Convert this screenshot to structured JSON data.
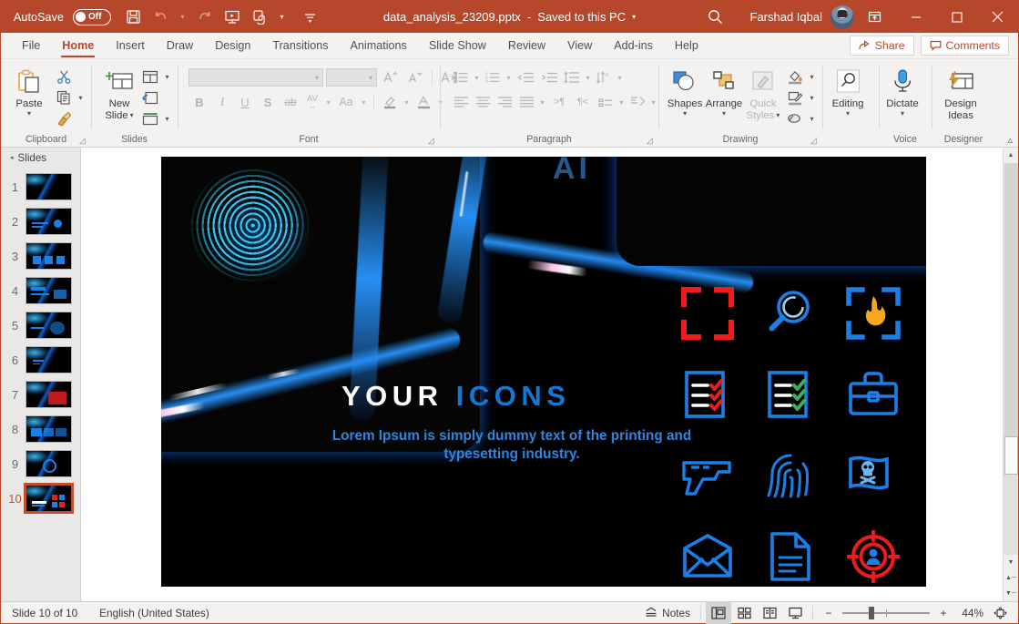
{
  "titlebar": {
    "autosave_label": "AutoSave",
    "autosave_state": "Off",
    "file_name": "data_analysis_23209.pptx",
    "separator": "-",
    "save_state": "Saved to this PC",
    "user_name": "Farshad Iqbal",
    "quick_access": [
      "save-icon",
      "undo-icon",
      "redo-icon",
      "start-presentation-icon",
      "touch-mode-icon"
    ],
    "search_icon": "search-icon",
    "window_buttons": [
      "ribbon-display-options",
      "minimize",
      "maximize",
      "close"
    ]
  },
  "ribbon": {
    "tabs": [
      {
        "label": "File",
        "active": false
      },
      {
        "label": "Home",
        "active": true
      },
      {
        "label": "Insert",
        "active": false
      },
      {
        "label": "Draw",
        "active": false
      },
      {
        "label": "Design",
        "active": false
      },
      {
        "label": "Transitions",
        "active": false
      },
      {
        "label": "Animations",
        "active": false
      },
      {
        "label": "Slide Show",
        "active": false
      },
      {
        "label": "Review",
        "active": false
      },
      {
        "label": "View",
        "active": false
      },
      {
        "label": "Add-ins",
        "active": false
      },
      {
        "label": "Help",
        "active": false
      }
    ],
    "share_label": "Share",
    "comments_label": "Comments",
    "groups": {
      "clipboard": {
        "label": "Clipboard",
        "paste_label": "Paste",
        "cut_label": "Cut",
        "copy_label": "Copy",
        "format_painter_label": "Format Painter"
      },
      "slides": {
        "label": "Slides",
        "new_slide_label": "New\nSlide",
        "new_slide_line1": "New",
        "new_slide_line2": "Slide",
        "layout_label": "Layout",
        "reset_label": "Reset",
        "section_label": "Section"
      },
      "font": {
        "label": "Font",
        "font_name_value": "",
        "font_size_value": "",
        "bold": "B",
        "italic": "I",
        "underline": "U",
        "shadow": "S",
        "strikethrough": "ab",
        "char_spacing": "AV",
        "change_case": "Aa",
        "grow_font": "A",
        "shrink_font": "A",
        "clear_formatting": "A"
      },
      "paragraph": {
        "label": "Paragraph"
      },
      "drawing": {
        "label": "Drawing",
        "shapes_label": "Shapes",
        "arrange_label": "Arrange",
        "quick_styles_line1": "Quick",
        "quick_styles_line2": "Styles"
      },
      "editing": {
        "label": "Editing",
        "editing_label": "Editing"
      },
      "voice": {
        "label": "Voice",
        "dictate_label": "Dictate"
      },
      "designer": {
        "label": "Designer",
        "design_ideas_line1": "Design",
        "design_ideas_line2": "Ideas"
      }
    }
  },
  "slide_panel": {
    "header": "Slides",
    "thumbnails": [
      {
        "number": "1",
        "selected": false
      },
      {
        "number": "2",
        "selected": false
      },
      {
        "number": "3",
        "selected": false
      },
      {
        "number": "4",
        "selected": false
      },
      {
        "number": "5",
        "selected": false
      },
      {
        "number": "6",
        "selected": false
      },
      {
        "number": "7",
        "selected": false
      },
      {
        "number": "8",
        "selected": false
      },
      {
        "number": "9",
        "selected": false
      },
      {
        "number": "10",
        "selected": true
      }
    ]
  },
  "slide": {
    "title_word1": "YOUR",
    "title_word2": "ICONS",
    "subtitle": "Lorem Ipsum is simply dummy text of the printing and typesetting industry.",
    "background_description": "fingerprint-on-glowing-blue-keyboard-photo",
    "ghost_text": "AI",
    "colors": {
      "accent_blue": "#1677d2",
      "subtitle_blue": "#2e86de",
      "icon_blue": "#1b7fe8",
      "icon_red": "#ee1c1c",
      "icon_green": "#3fae5a",
      "icon_orange": "#f5a81c",
      "background": "#000000"
    },
    "icons": [
      {
        "name": "scan-frame-red-icon",
        "color": "#ee1c1c"
      },
      {
        "name": "magnifier-icon",
        "color": "#1b7fe8"
      },
      {
        "name": "fire-scan-frame-icon",
        "color": "#1b7fe8"
      },
      {
        "name": "spacer",
        "color": ""
      },
      {
        "name": "checklist-red-icon",
        "color": "#ee1c1c"
      },
      {
        "name": "checklist-green-icon",
        "color": "#3fae5a"
      },
      {
        "name": "briefcase-icon",
        "color": "#1b7fe8"
      },
      {
        "name": "gavel-icon",
        "color": "#1b7fe8"
      },
      {
        "name": "gun-icon",
        "color": "#1b7fe8"
      },
      {
        "name": "fingerprint-icon",
        "color": "#1b7fe8"
      },
      {
        "name": "pirate-flag-icon",
        "color": "#1b7fe8"
      },
      {
        "name": "user-icon",
        "color": "#1b7fe8"
      },
      {
        "name": "envelope-icon",
        "color": "#1b7fe8"
      },
      {
        "name": "document-icon",
        "color": "#1b7fe8"
      },
      {
        "name": "target-person-icon",
        "color": "#ee1c1c"
      },
      {
        "name": "network-nodes-icon",
        "color": "#1b7fe8"
      }
    ]
  },
  "statusbar": {
    "slide_counter": "Slide 10 of 10",
    "language": "English (United States)",
    "notes_label": "Notes",
    "views": [
      "normal-view",
      "slide-sorter-view",
      "reading-view",
      "slideshow-view"
    ],
    "zoom_out": "−",
    "zoom_in": "+",
    "zoom_value": "44%",
    "fit_to_window": "fit-slide-to-window-icon"
  }
}
